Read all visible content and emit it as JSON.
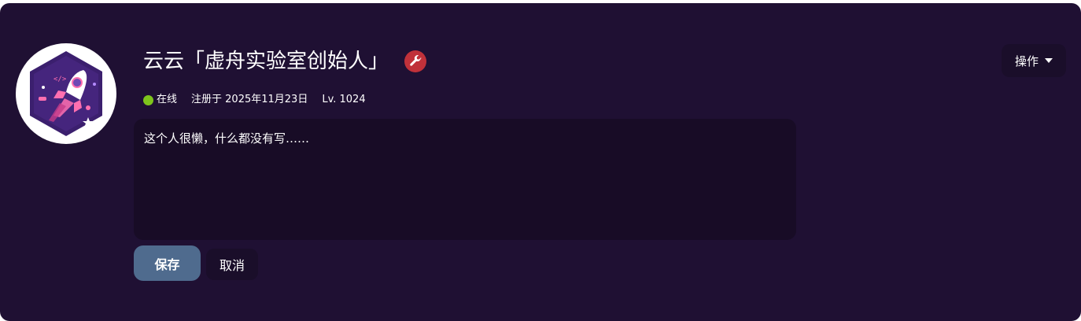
{
  "profile": {
    "name": "云云「虚舟实验室创始人」",
    "badge_icon": "wrench-icon",
    "status": "在线",
    "registered": "注册于 2025年11月23日",
    "level": "Lv. 1024",
    "bio": "这个人很懒，什么都没有写……",
    "avatar_icon": "rocket-icon"
  },
  "actions": {
    "save_label": "保存",
    "cancel_label": "取消",
    "ops_label": "操作"
  },
  "colors": {
    "card_background": "#1f1033",
    "bio_background": "#180c26",
    "save_button": "#4f6b8e",
    "status_online": "#7ec41c",
    "admin_badge": "#c0313a"
  }
}
